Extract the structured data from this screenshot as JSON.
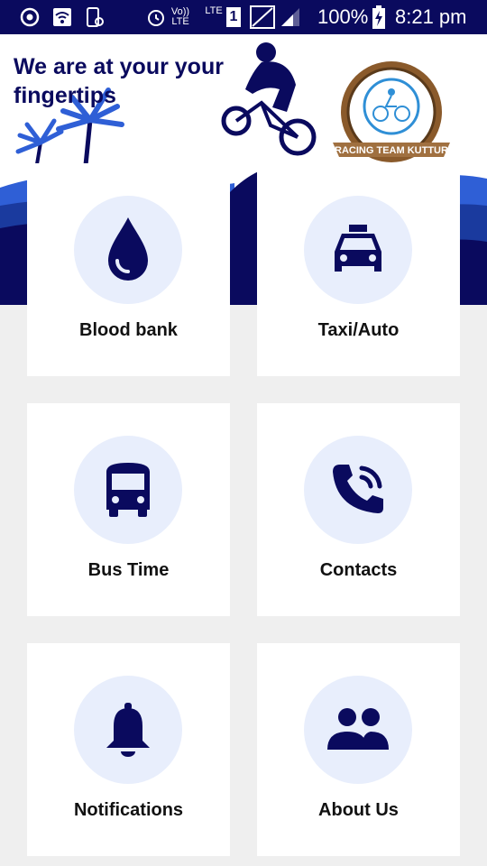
{
  "status_bar": {
    "battery": "100%",
    "time": "8:21 pm",
    "network_top": "Vo))",
    "network_bottom": "LTE",
    "lte_label": "LTE",
    "sim": "1"
  },
  "header": {
    "title": "We are at your your fingertips",
    "logo_text": "RACING TEAM KUTTUR"
  },
  "colors": {
    "primary": "#0a0a5e",
    "accent_blue": "#2f5fd6",
    "circle_bg": "#e8eefc",
    "page_bg": "#efefef"
  },
  "cards": [
    {
      "label": "Blood bank",
      "icon": "blood-drop-icon"
    },
    {
      "label": "Taxi/Auto",
      "icon": "taxi-icon"
    },
    {
      "label": "Bus Time",
      "icon": "bus-icon"
    },
    {
      "label": "Contacts",
      "icon": "phone-call-icon"
    },
    {
      "label": "Notifications",
      "icon": "bell-icon"
    },
    {
      "label": "About Us",
      "icon": "people-icon"
    }
  ]
}
